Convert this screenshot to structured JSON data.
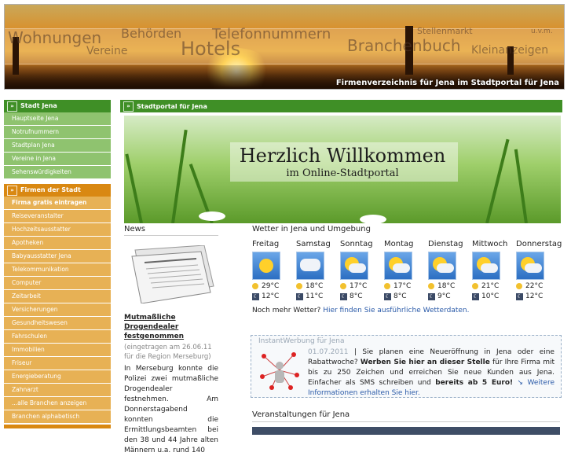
{
  "banner": {
    "words": [
      "Wohnungen",
      "Behörden",
      "Telefonnummern",
      "Stellenmarkt",
      "u.v.m.",
      "Vereine",
      "Hotels",
      "Branchenbuch",
      "Kleinanzeigen"
    ],
    "caption": "Firmenverzeichnis für Jena im Stadtportal für Jena"
  },
  "sidebar": {
    "city": {
      "heading": "Stadt Jena",
      "items": [
        "Hauptseite Jena",
        "Notrufnummern",
        "Stadtplan Jena",
        "Vereine in Jena",
        "Sehenswürdigkeiten"
      ]
    },
    "companies": {
      "heading": "Firmen der Stadt",
      "items": [
        "Firma gratis eintragen",
        "Reiseveranstalter",
        "Hochzeitsausstatter",
        "Apotheken",
        "Babyausstatter Jena",
        "Telekommunikation",
        "Computer",
        "Zeitarbeit",
        "Versicherungen",
        "Gesundheitswesen",
        "Fahrschulen",
        "Immobilien",
        "Friseur",
        "Energieberatung",
        "Zahnarzt",
        "...alle Branchen anzeigen",
        "Branchen alphabetisch"
      ]
    }
  },
  "main": {
    "heading": "Stadtportal für Jena",
    "welcome": {
      "title": "Herzlich Willkommen",
      "subtitle": "im Online-Stadtportal"
    }
  },
  "news": {
    "title": "News",
    "headline": "Mutmaßliche Drogendealer festgenommen",
    "meta": "(eingetragen am 26.06.11 für die Region Merseburg)",
    "body": "In Merseburg konnte die Polizei zwei mutmaßliche Drogendealer festnehmen. Am Donnerstagabend konnten die Ermittlungsbeamten bei den 38 und 44 Jahre alten Männern u.a. rund 140"
  },
  "weather": {
    "title": "Wetter in Jena und Umgebung",
    "days": [
      {
        "name": "Freitag",
        "day": "29°C",
        "night": "12°C",
        "icon": "sunny-icon"
      },
      {
        "name": "Samstag",
        "day": "18°C",
        "night": "11°C",
        "icon": "cloudy-icon"
      },
      {
        "name": "Sonntag",
        "day": "17°C",
        "night": "8°C",
        "icon": "partly-cloudy-icon"
      },
      {
        "name": "Montag",
        "day": "17°C",
        "night": "8°C",
        "icon": "partly-cloudy-icon"
      },
      {
        "name": "Dienstag",
        "day": "18°C",
        "night": "9°C",
        "icon": "partly-cloudy-icon"
      },
      {
        "name": "Mittwoch",
        "day": "21°C",
        "night": "10°C",
        "icon": "partly-cloudy-icon"
      },
      {
        "name": "Donnerstag",
        "day": "22°C",
        "night": "12°C",
        "icon": "partly-cloudy-icon"
      }
    ],
    "more_prefix": "Noch mehr Wetter?",
    "more_link": "Hier finden Sie ausführliche Wetterdaten."
  },
  "ad": {
    "label": "InstantWerbung für Jena",
    "date": "01.07.2011",
    "sep": "|",
    "text1": "Sie planen eine Neueröffnung in Jena oder eine Rabattwoche?",
    "bold1": "Werben Sie hier an dieser Stelle",
    "text2": "für Ihre Firma mit bis zu 250 Zeichen und erreichen Sie neue Kunden aus Jena. Einfacher als SMS schreiben und",
    "bold2": "bereits ab 5 Euro!",
    "link": "Weitere Informationen erhalten Sie hier."
  },
  "events": {
    "title": "Veranstaltungen für Jena"
  }
}
